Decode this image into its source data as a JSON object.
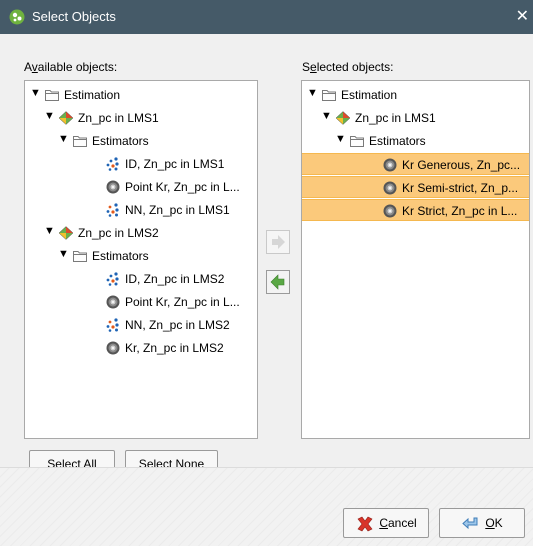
{
  "window": {
    "title": "Select Objects",
    "close_symbol": "✕"
  },
  "available": {
    "label_pre": "A",
    "label_u": "v",
    "label_post": "ailable objects:",
    "items": [
      {
        "label": "Estimation",
        "icon": "folder-icon",
        "expanded": true,
        "level": 0
      },
      {
        "label": "Zn_pc in LMS1",
        "icon": "estimation-model-icon",
        "expanded": true,
        "level": 1
      },
      {
        "label": "Estimators",
        "icon": "folder-icon",
        "expanded": true,
        "level": 2
      },
      {
        "label": "ID, Zn_pc in LMS1",
        "icon": "id-estimator-icon",
        "level": 3
      },
      {
        "label": "Point Kr, Zn_pc in L...",
        "icon": "kriging-estimator-icon",
        "level": 3
      },
      {
        "label": "NN, Zn_pc in LMS1",
        "icon": "nn-estimator-icon",
        "level": 3
      },
      {
        "label": "Zn_pc in LMS2",
        "icon": "estimation-model-icon",
        "expanded": true,
        "level": 1
      },
      {
        "label": "Estimators",
        "icon": "folder-icon",
        "expanded": true,
        "level": 2
      },
      {
        "label": "ID, Zn_pc in LMS2",
        "icon": "id-estimator-icon",
        "level": 3
      },
      {
        "label": "Point Kr, Zn_pc in L...",
        "icon": "kriging-estimator-icon",
        "level": 3
      },
      {
        "label": "NN, Zn_pc in LMS2",
        "icon": "nn-estimator-icon",
        "level": 3
      },
      {
        "label": "Kr, Zn_pc in LMS2",
        "icon": "kriging-estimator-icon",
        "level": 3
      }
    ]
  },
  "selected": {
    "label_pre": "S",
    "label_u": "e",
    "label_post": "lected objects:",
    "items": [
      {
        "label": "Estimation",
        "icon": "folder-icon",
        "expanded": true,
        "level": 0
      },
      {
        "label": "Zn_pc in LMS1",
        "icon": "estimation-model-icon",
        "expanded": true,
        "level": 1
      },
      {
        "label": "Estimators",
        "icon": "folder-icon",
        "expanded": true,
        "level": 2
      },
      {
        "label": "Kr Generous, Zn_pc...",
        "icon": "kriging-estimator-icon",
        "level": 3,
        "highlighted": true
      },
      {
        "label": "Kr Semi-strict, Zn_p...",
        "icon": "kriging-estimator-icon",
        "level": 3,
        "highlighted": true
      },
      {
        "label": "Kr Strict, Zn_pc in L...",
        "icon": "kriging-estimator-icon",
        "level": 3,
        "highlighted": true
      }
    ]
  },
  "buttons": {
    "select_all_pre": "Select ",
    "select_all_u": "A",
    "select_all_post": "ll",
    "select_none_pre": "",
    "select_none_u": "S",
    "select_none_post": "elect None",
    "cancel_pre": "",
    "cancel_u": "C",
    "cancel_post": "ancel",
    "ok_pre": "",
    "ok_u": "O",
    "ok_post": "K"
  },
  "colors": {
    "titlebar": "#455a68",
    "highlight": "#fbc97b",
    "arrow_green": "#5aa845"
  }
}
